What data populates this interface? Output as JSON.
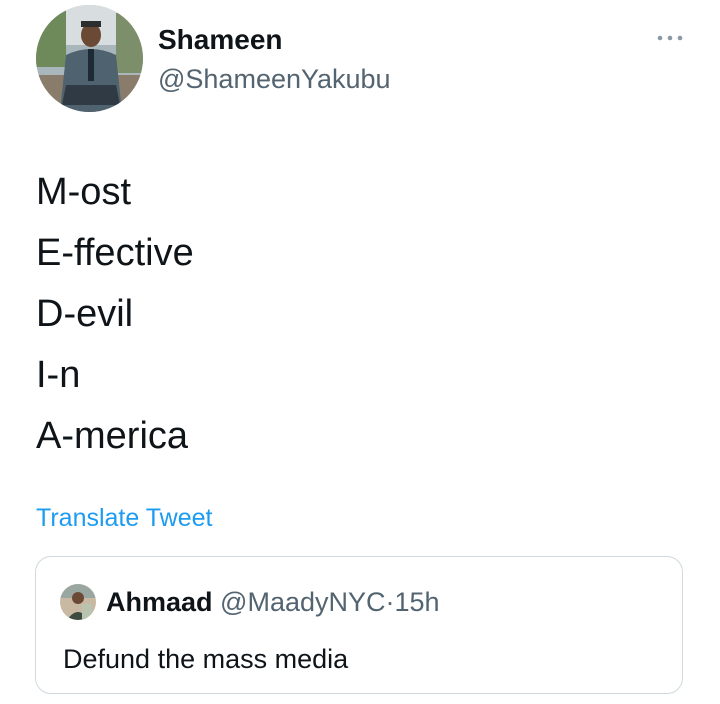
{
  "tweet": {
    "author": {
      "display_name": "Shameen",
      "handle": "@ShameenYakubu"
    },
    "more_icon": "more-horizontal-icon",
    "lines": [
      "M-ost",
      "E-ffective",
      "D-evil",
      "I-n",
      "A-merica"
    ],
    "translate_label": "Translate Tweet"
  },
  "quoted_tweet": {
    "display_name": "Ahmaad",
    "handle": "@MaadyNYC",
    "separator": "·",
    "time": "15h",
    "text": "Defund the mass media"
  },
  "colors": {
    "link": "#1d9bf0",
    "secondary_text": "#536471",
    "border": "#cfd9de"
  }
}
